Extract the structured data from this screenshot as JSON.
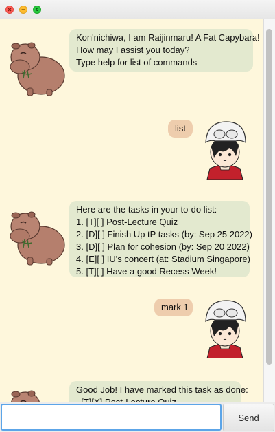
{
  "window": {
    "traffic_lights": [
      "close-button",
      "minimize-button",
      "zoom-button"
    ],
    "colors": {
      "close": "#ff5f57",
      "minimize": "#febc2e",
      "zoom": "#28c840"
    }
  },
  "chat": {
    "background": "#fef7dc",
    "bot_bubble_color": "#e3e9cf",
    "user_bubble_color": "#eecdad",
    "messages": [
      {
        "sender": "bot",
        "avatar": "capybara-avatar",
        "lines": [
          "Kon'nichiwa, I am Raijinmaru! A Fat Capybara!",
          "How may I assist you today?",
          "Type help for list of commands"
        ]
      },
      {
        "sender": "user",
        "avatar": "helmet-boy-avatar",
        "lines": [
          "list"
        ]
      },
      {
        "sender": "bot",
        "avatar": "capybara-avatar",
        "lines": [
          "Here are the tasks in your to-do list:",
          "1. [T][ ] Post-Lecture Quiz",
          "2. [D][ ] Finish Up tP tasks (by: Sep 25 2022)",
          "3. [D][ ] Plan for cohesion (by: Sep 20 2022)",
          "4. [E][ ] IU's concert (at: Stadium Singapore)",
          "5. [T][ ] Have a good Recess Week!"
        ]
      },
      {
        "sender": "user",
        "avatar": "helmet-boy-avatar",
        "lines": [
          "mark 1"
        ]
      },
      {
        "sender": "bot",
        "avatar": "capybara-avatar",
        "lines": [
          "Good Job! I have marked this task as done:",
          "  [T][X] Post-Lecture Quiz"
        ]
      }
    ]
  },
  "input": {
    "value": "",
    "placeholder": ""
  },
  "send_button": {
    "label": "Send"
  }
}
